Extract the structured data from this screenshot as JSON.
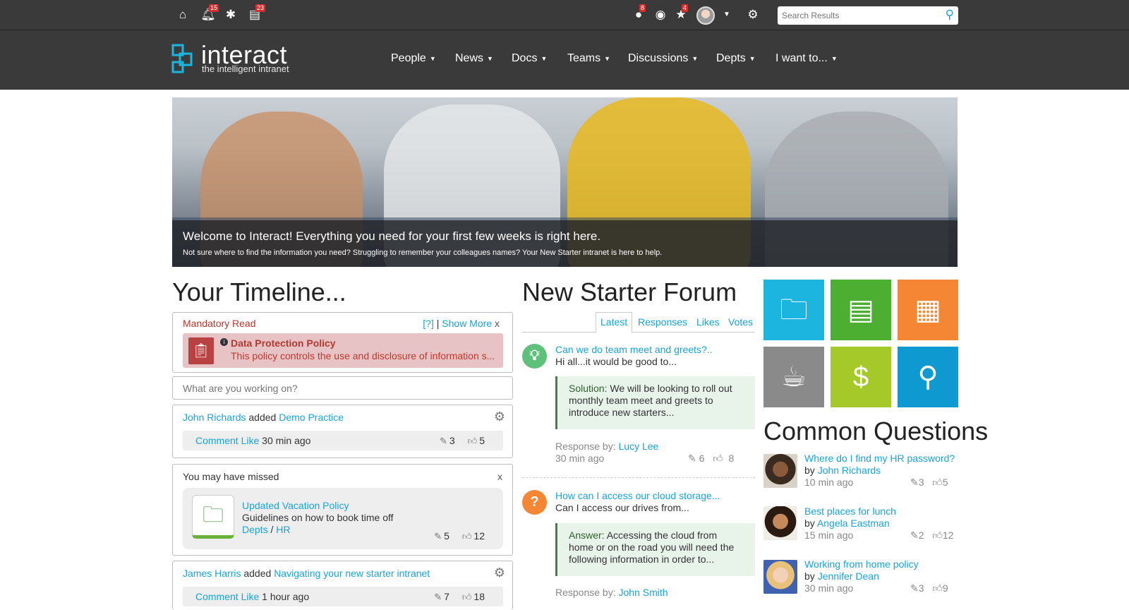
{
  "topbar": {
    "notifications_badge": "15",
    "approvals_badge": "23",
    "alerts_badge": "8",
    "favourites_badge": "4",
    "search_placeholder": "Search Results"
  },
  "brand": {
    "name": "interact",
    "tagline": "the intelligent intranet"
  },
  "nav": [
    "People",
    "News",
    "Docs",
    "Teams",
    "Discussions",
    "Depts",
    "I want to..."
  ],
  "hero": {
    "title": "Welcome to Interact! Everything you need for your first few weeks is right here.",
    "subtitle": "Not sure where to find the information you need? Struggling to remember your colleagues names? Your New Starter intranet is here to help."
  },
  "timeline": {
    "heading": "Your Timeline...",
    "mandatory": {
      "label": "Mandatory Read",
      "help": "[?]",
      "separator": "|",
      "show_more": "Show More",
      "close": "x",
      "title": "Data Protection Policy",
      "description": "This policy controls the use and disclosure of information s..."
    },
    "status_placeholder": "What are you working on?",
    "activity1": {
      "user": "John Richards",
      "verb": "added",
      "item": "Demo Practice",
      "comment": "Comment",
      "like": "Like",
      "time": "30 min ago",
      "comments": "3",
      "likes": "5"
    },
    "missed": {
      "title": "You may have missed",
      "close": "x",
      "item_title": "Updated Vacation Policy",
      "item_desc": "Guidelines on how to book time off",
      "crumb1": "Depts",
      "crumb_sep": "/",
      "crumb2": "HR",
      "comments": "5",
      "likes": "12"
    },
    "activity2": {
      "user": "James Harris",
      "verb": "added",
      "item": "Navigating your new starter intranet",
      "comment": "Comment",
      "like": "Like",
      "time": "1 hour ago",
      "comments": "7",
      "likes": "18"
    }
  },
  "forum": {
    "heading": "New Starter Forum",
    "tabs": [
      "Latest",
      "Responses",
      "Likes",
      "Votes"
    ],
    "posts": [
      {
        "question": "Can we do team meet and greets?..",
        "excerpt": "Hi all...it would be good to...",
        "answer_label": "Solution:",
        "answer_text": "We will be looking to roll out monthly team meet and greets to introduce new starters...",
        "response_label": "Response by:",
        "responder": "Lucy Lee",
        "time": "30 min ago",
        "comments": "6",
        "likes": "8"
      },
      {
        "question": "How can I access our cloud storage...",
        "excerpt": "Can I access our drives from...",
        "answer_label": "Answer:",
        "answer_text": "Accessing the cloud from home or on the road you will need the following information in order to...",
        "response_label": "Response by:",
        "responder": "John Smith"
      }
    ]
  },
  "tiles": [
    {
      "icon": "folder-icon",
      "color": "#1cb5e0"
    },
    {
      "icon": "clipboard-icon",
      "color": "#4caf32"
    },
    {
      "icon": "calendar-icon",
      "color": "#f58634"
    },
    {
      "icon": "coffee-icon",
      "color": "#8a8a8a"
    },
    {
      "icon": "wallet-icon",
      "color": "#a4c928"
    },
    {
      "icon": "map-pin-icon",
      "color": "#0e9ad1"
    }
  ],
  "questions": {
    "heading": "Common Questions",
    "items": [
      {
        "title": "Where do I find my HR password?",
        "by": "by",
        "author": "John Richards",
        "time": "10 min ago",
        "comments": "3",
        "likes": "5"
      },
      {
        "title": "Best places for lunch",
        "by": "by",
        "author": "Angela Eastman",
        "time": "15 min ago",
        "comments": "2",
        "likes": "12"
      },
      {
        "title": "Working from home policy",
        "by": "by",
        "author": "Jennifer Dean",
        "time": "30 min ago",
        "comments": "3",
        "likes": "9"
      }
    ]
  }
}
